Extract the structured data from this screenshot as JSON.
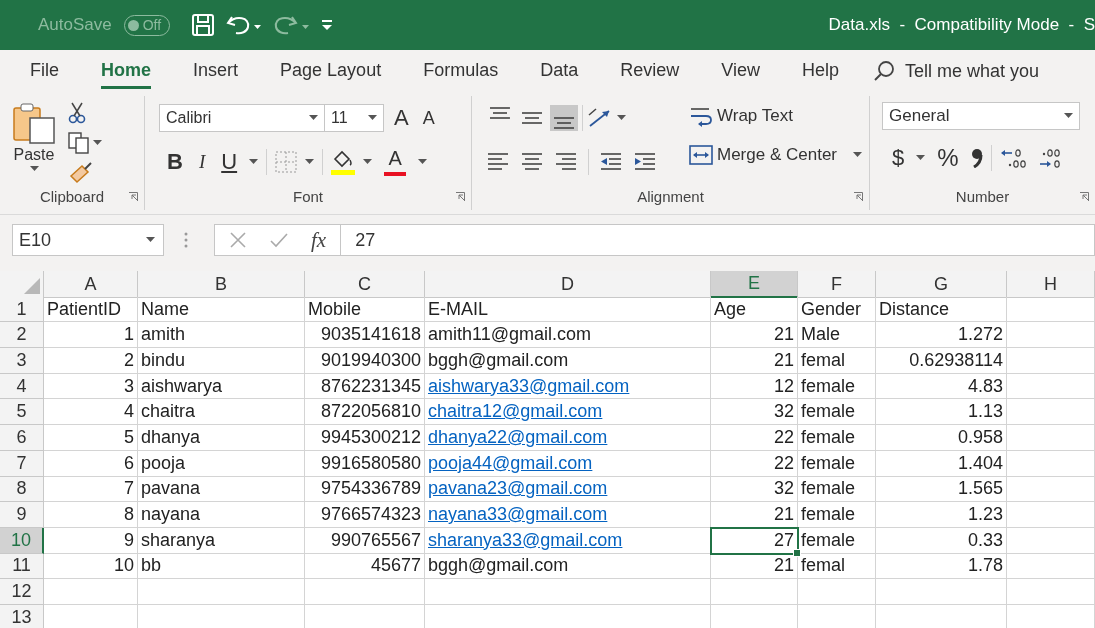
{
  "title_bar": {
    "autosave_label": "AutoSave",
    "autosave_toggle": {
      "label": "Off",
      "on": false
    },
    "title": "Data.xls  -  Compatibility Mode  -  S"
  },
  "menu_tabs": [
    {
      "label": "File",
      "selected": false
    },
    {
      "label": "Home",
      "selected": true
    },
    {
      "label": "Insert",
      "selected": false
    },
    {
      "label": "Page Layout",
      "selected": false
    },
    {
      "label": "Formulas",
      "selected": false
    },
    {
      "label": "Data",
      "selected": false
    },
    {
      "label": "Review",
      "selected": false
    },
    {
      "label": "View",
      "selected": false
    },
    {
      "label": "Help",
      "selected": false
    }
  ],
  "tell_me": {
    "placeholder": "Tell me what you"
  },
  "ribbon": {
    "clipboard": {
      "paste": "Paste",
      "label": "Clipboard"
    },
    "font": {
      "name": "Calibri",
      "size": "11",
      "grow": "A",
      "shrink": "A",
      "bold": "B",
      "italic": "I",
      "underline": "U",
      "font_color": "A",
      "label": "Font"
    },
    "alignment": {
      "vertical_align_buttons": [
        {
          "selected": false
        },
        {
          "selected": false
        },
        {
          "selected": true
        }
      ],
      "wrap_text": "Wrap Text",
      "merge_center": "Merge & Center",
      "label": "Alignment"
    },
    "number": {
      "format": "General",
      "currency": "$",
      "percent": "%",
      "label": "Number"
    }
  },
  "formula_bar": {
    "name_box": "E10",
    "fx": "fx",
    "value": "27"
  },
  "sheet": {
    "columns": [
      {
        "letter": "A",
        "selected": false
      },
      {
        "letter": "B",
        "selected": false
      },
      {
        "letter": "C",
        "selected": false
      },
      {
        "letter": "D",
        "selected": false
      },
      {
        "letter": "E",
        "selected": true
      },
      {
        "letter": "F",
        "selected": false
      },
      {
        "letter": "G",
        "selected": false
      },
      {
        "letter": "H",
        "selected": false
      }
    ],
    "rows": [
      {
        "number": "1",
        "selected": false,
        "cells": [
          {
            "text": "PatientID",
            "kind": "text"
          },
          {
            "text": "Name",
            "kind": "text"
          },
          {
            "text": "Mobile",
            "kind": "text"
          },
          {
            "text": "E-MAIL",
            "kind": "text"
          },
          {
            "text": "Age",
            "kind": "text"
          },
          {
            "text": "Gender",
            "kind": "text"
          },
          {
            "text": "Distance",
            "kind": "text"
          }
        ]
      },
      {
        "number": "2",
        "selected": false,
        "cells": [
          {
            "text": "1",
            "kind": "number"
          },
          {
            "text": "amith",
            "kind": "text"
          },
          {
            "text": "9035141618",
            "kind": "number"
          },
          {
            "text": "amith11@gmail.com",
            "kind": "text"
          },
          {
            "text": "21",
            "kind": "number"
          },
          {
            "text": "Male",
            "kind": "text"
          },
          {
            "text": "1.272",
            "kind": "number"
          }
        ]
      },
      {
        "number": "3",
        "selected": false,
        "cells": [
          {
            "text": "2",
            "kind": "number"
          },
          {
            "text": "bindu",
            "kind": "text"
          },
          {
            "text": "9019940300",
            "kind": "number"
          },
          {
            "text": "bggh@gmail.com",
            "kind": "text"
          },
          {
            "text": "21",
            "kind": "number"
          },
          {
            "text": "femal",
            "kind": "text"
          },
          {
            "text": "0.62938114",
            "kind": "number"
          }
        ]
      },
      {
        "number": "4",
        "selected": false,
        "cells": [
          {
            "text": "3",
            "kind": "number"
          },
          {
            "text": "aishwarya",
            "kind": "text"
          },
          {
            "text": "8762231345",
            "kind": "number"
          },
          {
            "text": "aishwarya33@gmail.com",
            "kind": "link"
          },
          {
            "text": "12",
            "kind": "number"
          },
          {
            "text": "female",
            "kind": "text"
          },
          {
            "text": "4.83",
            "kind": "number"
          }
        ]
      },
      {
        "number": "5",
        "selected": false,
        "cells": [
          {
            "text": "4",
            "kind": "number"
          },
          {
            "text": "chaitra",
            "kind": "text"
          },
          {
            "text": "8722056810",
            "kind": "number"
          },
          {
            "text": "chaitra12@gmail.com",
            "kind": "link"
          },
          {
            "text": "32",
            "kind": "number"
          },
          {
            "text": "female",
            "kind": "text"
          },
          {
            "text": "1.13",
            "kind": "number"
          }
        ]
      },
      {
        "number": "6",
        "selected": false,
        "cells": [
          {
            "text": "5",
            "kind": "number"
          },
          {
            "text": "dhanya",
            "kind": "text"
          },
          {
            "text": "9945300212",
            "kind": "number"
          },
          {
            "text": "dhanya22@gmail.com",
            "kind": "link"
          },
          {
            "text": "22",
            "kind": "number"
          },
          {
            "text": "female",
            "kind": "text"
          },
          {
            "text": "0.958",
            "kind": "number"
          }
        ]
      },
      {
        "number": "7",
        "selected": false,
        "cells": [
          {
            "text": "6",
            "kind": "number"
          },
          {
            "text": "pooja",
            "kind": "text"
          },
          {
            "text": "9916580580",
            "kind": "number"
          },
          {
            "text": "pooja44@gmail.com",
            "kind": "link"
          },
          {
            "text": "22",
            "kind": "number"
          },
          {
            "text": "female",
            "kind": "text"
          },
          {
            "text": "1.404",
            "kind": "number"
          }
        ]
      },
      {
        "number": "8",
        "selected": false,
        "cells": [
          {
            "text": "7",
            "kind": "number"
          },
          {
            "text": "pavana",
            "kind": "text"
          },
          {
            "text": "9754336789",
            "kind": "number"
          },
          {
            "text": "pavana23@gmail.com",
            "kind": "link"
          },
          {
            "text": "32",
            "kind": "number"
          },
          {
            "text": "female",
            "kind": "text"
          },
          {
            "text": "1.565",
            "kind": "number"
          }
        ]
      },
      {
        "number": "9",
        "selected": false,
        "cells": [
          {
            "text": "8",
            "kind": "number"
          },
          {
            "text": "nayana",
            "kind": "text"
          },
          {
            "text": "9766574323",
            "kind": "number"
          },
          {
            "text": "nayana33@gmail.com",
            "kind": "link"
          },
          {
            "text": "21",
            "kind": "number"
          },
          {
            "text": "female",
            "kind": "text"
          },
          {
            "text": "1.23",
            "kind": "number"
          }
        ]
      },
      {
        "number": "10",
        "selected": true,
        "cells": [
          {
            "text": "9",
            "kind": "number"
          },
          {
            "text": "sharanya",
            "kind": "text"
          },
          {
            "text": "990765567",
            "kind": "number"
          },
          {
            "text": "sharanya33@gmail.com",
            "kind": "link"
          },
          {
            "text": "27",
            "kind": "number"
          },
          {
            "text": "female",
            "kind": "text"
          },
          {
            "text": "0.33",
            "kind": "number"
          }
        ]
      },
      {
        "number": "11",
        "selected": false,
        "cells": [
          {
            "text": "10",
            "kind": "number"
          },
          {
            "text": "bb",
            "kind": "text"
          },
          {
            "text": "45677",
            "kind": "number"
          },
          {
            "text": "bggh@gmail.com",
            "kind": "text"
          },
          {
            "text": "21",
            "kind": "number"
          },
          {
            "text": "femal",
            "kind": "text"
          },
          {
            "text": "1.78",
            "kind": "number"
          }
        ]
      },
      {
        "number": "12",
        "selected": false
      },
      {
        "number": "13",
        "selected": false
      }
    ]
  }
}
